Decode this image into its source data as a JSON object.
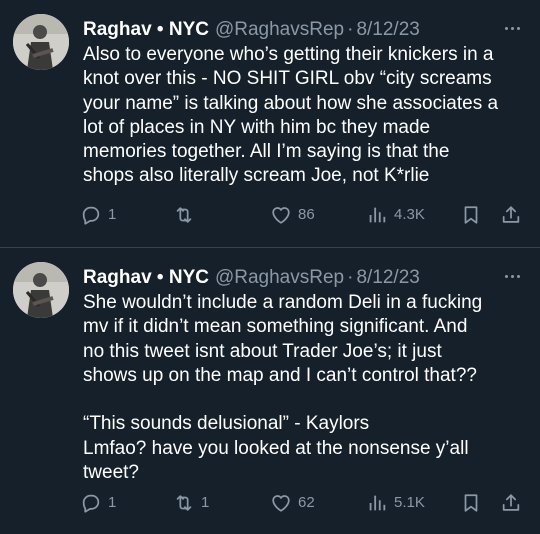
{
  "tweets": [
    {
      "author": {
        "display_name": "Raghav • NYC",
        "handle": "@RaghavsRep",
        "separator": "·",
        "date": "8/12/23",
        "avatar_icon": "profile-photo"
      },
      "text": "Also to everyone who’s getting their knickers in a\nknot over this - NO SHIT GIRL obv “city screams\nyour name” is talking about how she associates a\nlot of places in NY with him bc they made\nmemories together. All I’m saying is that the\nshops also literally scream Joe, not K*rlie",
      "actions": {
        "replies": "1",
        "reposts": "",
        "likes": "86",
        "views": "4.3K"
      }
    },
    {
      "author": {
        "display_name": "Raghav • NYC",
        "handle": "@RaghavsRep",
        "separator": "·",
        "date": "8/12/23",
        "avatar_icon": "profile-photo"
      },
      "text": "She wouldn’t include a random Deli in a fucking\nmv if it didn’t mean something significant. And\nno this tweet isnt about Trader Joe’s; it just\nshows up on the map and I can’t control that??\n\n“This sounds delusional” - Kaylors\nLmfao? have you looked at the nonsense y’all\ntweet?",
      "actions": {
        "replies": "1",
        "reposts": "1",
        "likes": "62",
        "views": "5.1K"
      }
    }
  ],
  "colors": {
    "background": "#15202b",
    "text_primary": "#ffffff",
    "text_secondary": "#8b98a5",
    "divider": "#38444d"
  }
}
